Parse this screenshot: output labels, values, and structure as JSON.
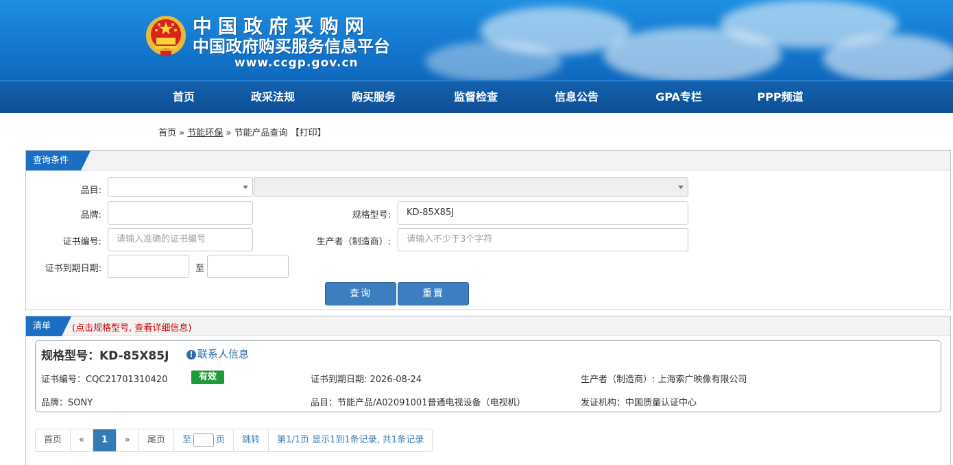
{
  "header": {
    "title": "中国政府采购网",
    "subtitle": "中国政府购买服务信息平台",
    "url": "www.ccgp.gov.cn"
  },
  "nav": [
    "首页",
    "政采法规",
    "购买服务",
    "监督检查",
    "信息公告",
    "GPA专栏",
    "PPP频道"
  ],
  "breadcrumb": {
    "home": "首页",
    "sep": "»",
    "section": "节能环保",
    "page": "节能产品查询",
    "print": "【打印】"
  },
  "query": {
    "tab": "查询条件",
    "labels": {
      "category": "品目:",
      "brand": "品牌:",
      "model": "规格型号:",
      "cert_no": "证书编号:",
      "manufacturer": "生产者（制造商）:",
      "expire": "证书到期日期:",
      "to": "至"
    },
    "values": {
      "brand": "",
      "model": "KD-85X85J",
      "expire_from": "",
      "expire_to": ""
    },
    "placeholders": {
      "cert_no": "请输入准确的证书编号",
      "manufacturer": "请输入不少于3个字符"
    },
    "buttons": {
      "search": "查询",
      "reset": "重置"
    }
  },
  "list": {
    "tab": "清单",
    "hint": "(点击规格型号, 查看详细信息)",
    "item": {
      "title": "规格型号：KD-85X85J",
      "contact": "联系人信息",
      "cert_no": "证书编号：CQC21701310420",
      "status": "有效",
      "expire": "证书到期日期: 2026-08-24",
      "manufacturer": "生产者（制造商）: 上海索广映像有限公司",
      "brand": "品牌：SONY",
      "category": "品目：节能产品/A02091001普通电视设备（电视机）",
      "issuer": "发证机构：中国质量认证中心"
    },
    "pager": {
      "first": "首页",
      "prev": "«",
      "current": "1",
      "next": "»",
      "last": "尾页",
      "to": "至",
      "page_unit": "页",
      "jump": "跳转",
      "summary": "第1/1页  显示1到1条记录, 共1条记录"
    }
  },
  "colors": {
    "banner": "#1478cf",
    "nav": "#0e4f95",
    "tab": "#1a6fc3",
    "button": "#3c7ec0",
    "status_valid": "#1e9a3b",
    "hint": "#cc0000"
  }
}
